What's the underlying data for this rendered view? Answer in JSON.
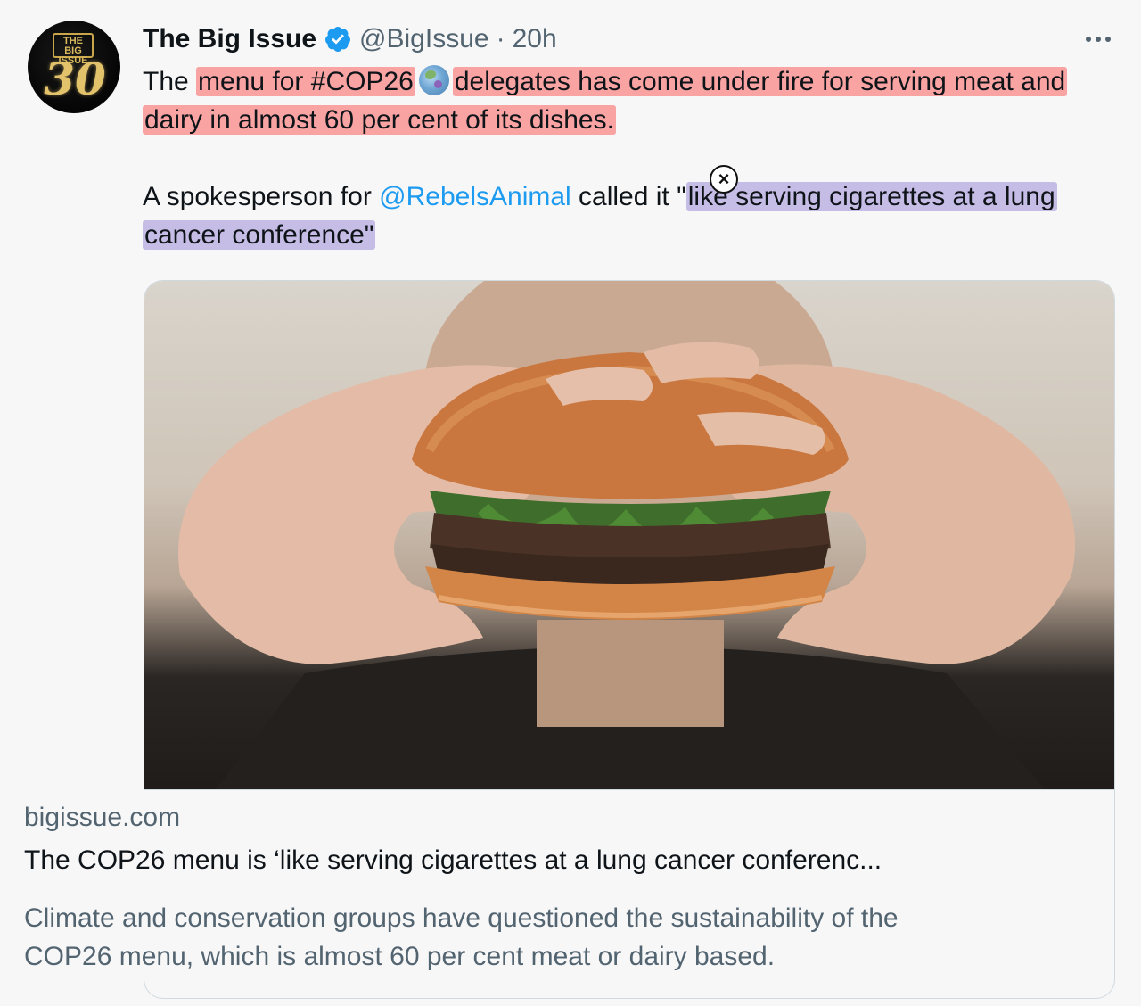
{
  "author": {
    "display_name": "The Big Issue",
    "handle": "@BigIssue",
    "separator": "·",
    "time": "20h",
    "avatar_text_top": "THE BIG ISSUE",
    "avatar_text_number": "30"
  },
  "tweet": {
    "p1_prefix": "The ",
    "p1_hl_a": "menu for #COP26",
    "p1_hl_b": "delegates has come under fire for serving meat and dairy in almost 60 per cent of its dishes.",
    "p2_prefix": "A spokesperson for ",
    "p2_mention": "@RebelsAnimal",
    "p2_mid": " called it \"",
    "p2_quote": "like serving cigarettes at a lung cancer conference\""
  },
  "card": {
    "domain": "bigissue.com",
    "title": "The COP26 menu is ‘like serving cigarettes at a lung cancer conferenc...",
    "description": "Climate and conservation groups have questioned the sustainability of the COP26 menu, which is almost 60 per cent meat or dairy based."
  },
  "icons": {
    "verified": "verified-badge-icon",
    "more": "more-options-icon",
    "globe": "globe-emoji-icon",
    "close": "close-icon"
  },
  "colors": {
    "highlight_red": "#f9a3a3",
    "highlight_purple": "#c6bde6",
    "link": "#1d9bf0",
    "muted": "#536471"
  }
}
